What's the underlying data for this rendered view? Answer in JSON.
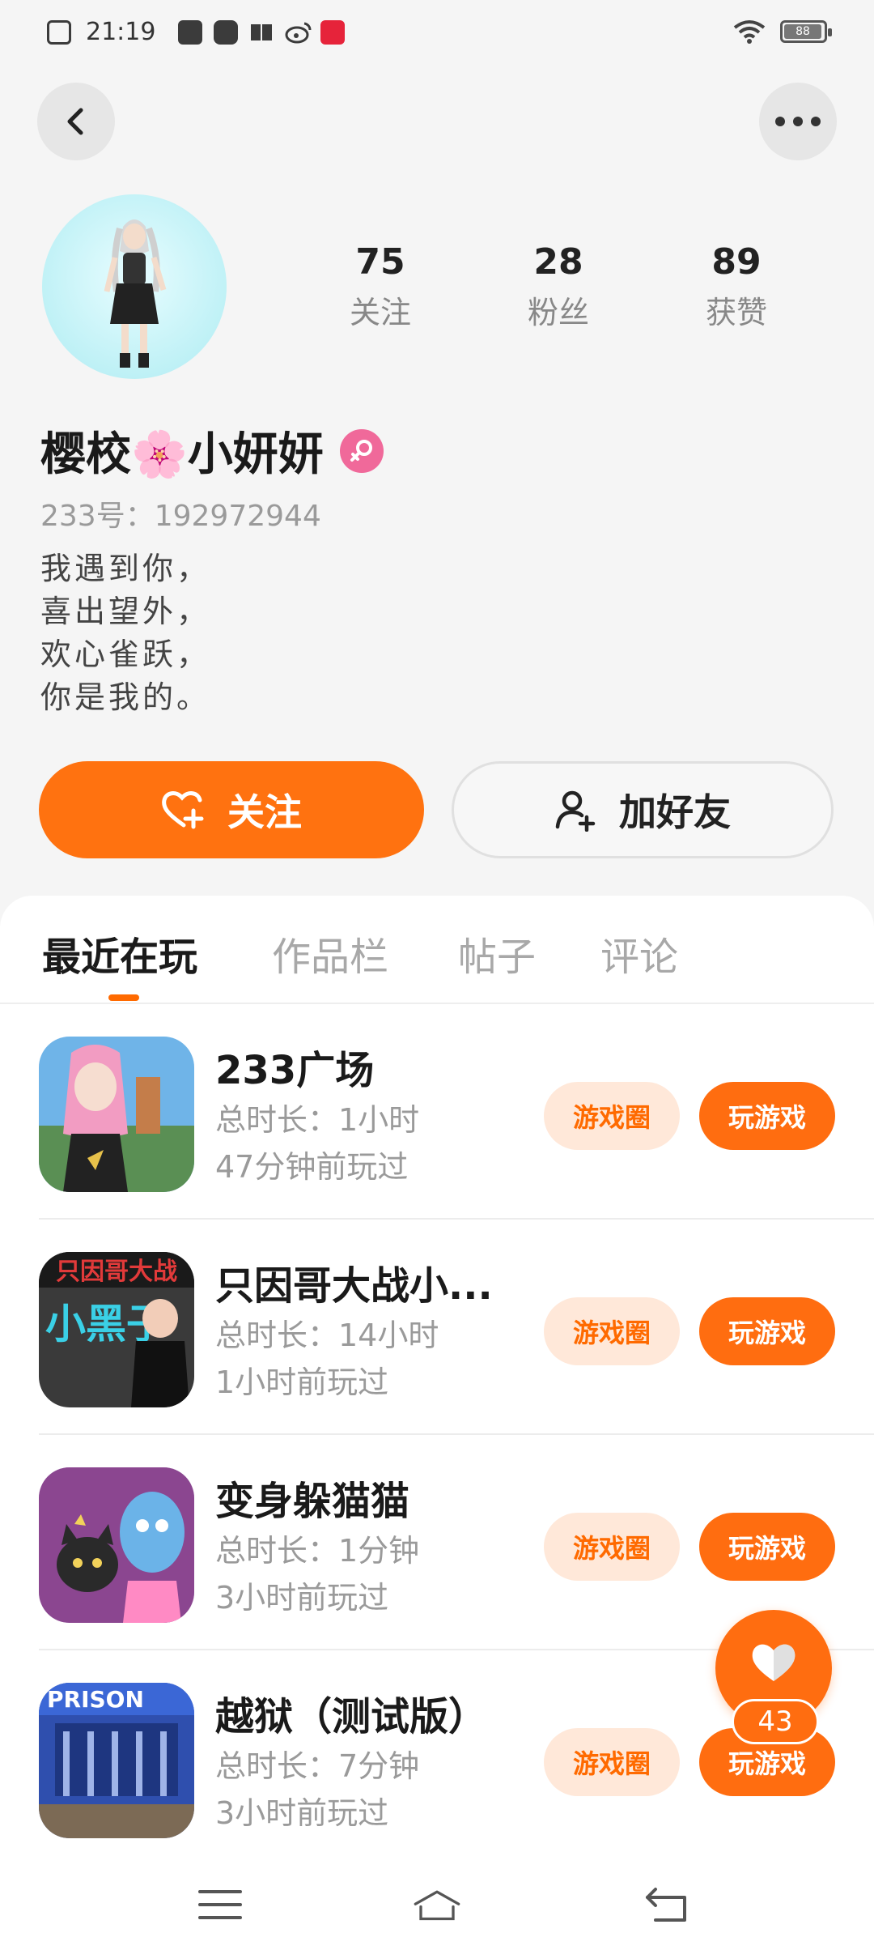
{
  "status_bar": {
    "time": "21:19",
    "battery_level": "88",
    "notification_icons": [
      "close-box-icon",
      "bag-icon",
      "play-icon",
      "book-icon",
      "weibo-icon",
      "app-icon"
    ]
  },
  "profile": {
    "stats": [
      {
        "value": "75",
        "label": "关注"
      },
      {
        "value": "28",
        "label": "粉丝"
      },
      {
        "value": "89",
        "label": "获赞"
      }
    ],
    "nickname": "樱校🌸小妍妍",
    "uid": "233号：192972944",
    "bio": [
      "我遇到你，",
      "喜出望外，",
      "欢心雀跃，",
      "你是我的。"
    ],
    "follow_label": "关注",
    "add_friend_label": "加好友"
  },
  "tabs": [
    {
      "label": "最近在玩",
      "active": true
    },
    {
      "label": "作品栏",
      "active": false
    },
    {
      "label": "帖子",
      "active": false
    },
    {
      "label": "评论",
      "active": false
    }
  ],
  "games": [
    {
      "title": "233广场",
      "duration": "总时长：1小时",
      "last_played": "47分钟前玩过",
      "circle_label": "游戏圈",
      "play_label": "玩游戏"
    },
    {
      "title": "只因哥大战小...",
      "duration": "总时长：14小时",
      "last_played": "1小时前玩过",
      "circle_label": "游戏圈",
      "play_label": "玩游戏"
    },
    {
      "title": "变身躲猫猫",
      "duration": "总时长：1分钟",
      "last_played": "3小时前玩过",
      "circle_label": "游戏圈",
      "play_label": "玩游戏"
    },
    {
      "title": "越狱（测试版）",
      "duration": "总时长：7分钟",
      "last_played": "3小时前玩过",
      "circle_label": "游戏圈",
      "play_label": "玩游戏"
    }
  ],
  "game_icon_texts": {
    "game2_banner": "只因哥大战",
    "game2_big": "小黑子",
    "game4_banner": "PRISON"
  },
  "like_fab": {
    "count": "43"
  },
  "colors": {
    "accent": "#ff6d10",
    "accent_light": "#ffe8d9",
    "gender": "#f0699a"
  }
}
